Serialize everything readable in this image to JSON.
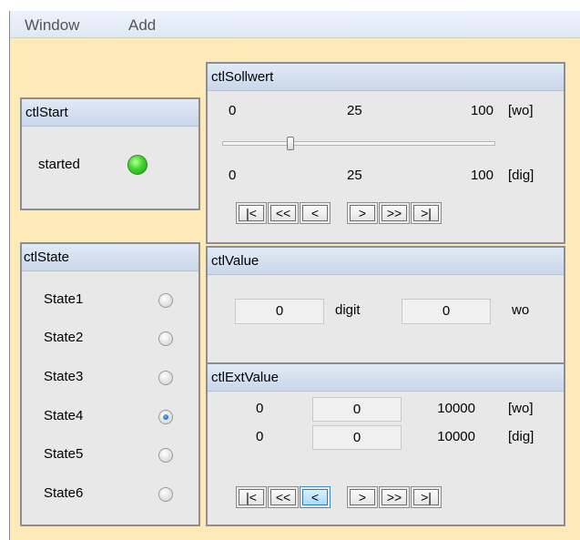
{
  "menu": {
    "items": [
      "Window",
      "Add"
    ]
  },
  "ctlStart": {
    "title": "ctlStart",
    "label": "started",
    "led_color": "#3fd62a"
  },
  "ctlSollwert": {
    "title": "ctlSollwert",
    "wo_row": {
      "min": "0",
      "val": "25",
      "max": "100",
      "unit": "[wo]"
    },
    "dig_row": {
      "min": "0",
      "val": "25",
      "max": "100",
      "unit": "[dig]"
    },
    "slider": {
      "min": 0,
      "max": 100,
      "value": 25
    },
    "nav": [
      "|<",
      "<<",
      "<",
      ">",
      ">>",
      ">|"
    ]
  },
  "ctlState": {
    "title": "ctlState",
    "states": [
      {
        "label": "State1",
        "checked": false
      },
      {
        "label": "State2",
        "checked": false
      },
      {
        "label": "State3",
        "checked": false
      },
      {
        "label": "State4",
        "checked": true
      },
      {
        "label": "State5",
        "checked": false
      },
      {
        "label": "State6",
        "checked": false
      }
    ]
  },
  "ctlValue": {
    "title": "ctlValue",
    "digit_value": "0",
    "digit_unit": "digit",
    "wo_value": "0",
    "wo_unit": "wo"
  },
  "ctlExtValue": {
    "title": "ctlExtValue",
    "wo_row": {
      "min": "0",
      "val": "0",
      "max": "10000",
      "unit": "[wo]"
    },
    "dig_row": {
      "min": "0",
      "val": "0",
      "max": "10000",
      "unit": "[dig]"
    },
    "nav": [
      "|<",
      "<<",
      "<",
      ">",
      ">>",
      ">|"
    ],
    "active_nav": "<"
  },
  "colors": {
    "background": "#fdeab8",
    "panel": "#e8e8e8",
    "active_button": "#a7dcfb"
  }
}
